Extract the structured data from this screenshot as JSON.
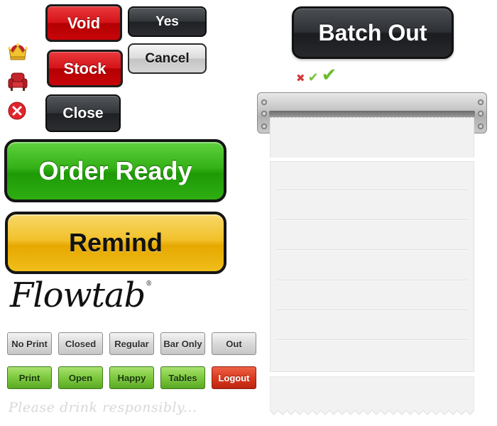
{
  "buttons": {
    "void": "Void",
    "yes": "Yes",
    "stock": "Stock",
    "cancel": "Cancel",
    "close": "Close",
    "order_ready": "Order Ready",
    "remind": "Remind",
    "batch_out": "Batch Out"
  },
  "logo": {
    "name": "Flowtab",
    "mark": "®"
  },
  "options_grey": [
    "No Print",
    "Closed",
    "Regular",
    "Bar Only",
    "Out"
  ],
  "options_colored": [
    "Print",
    "Open",
    "Happy",
    "Tables",
    "Logout"
  ],
  "tagline": "Please drink responsibly...",
  "icons": [
    "crown-icon",
    "armchair-icon",
    "close-circle-icon",
    "x-mark-icon",
    "check-small-icon",
    "check-large-icon"
  ],
  "colors": {
    "red": "#d41418",
    "green": "#34b116",
    "yellow": "#f1c12a",
    "dark": "#2d3034",
    "logout_red": "#d93a1f"
  }
}
